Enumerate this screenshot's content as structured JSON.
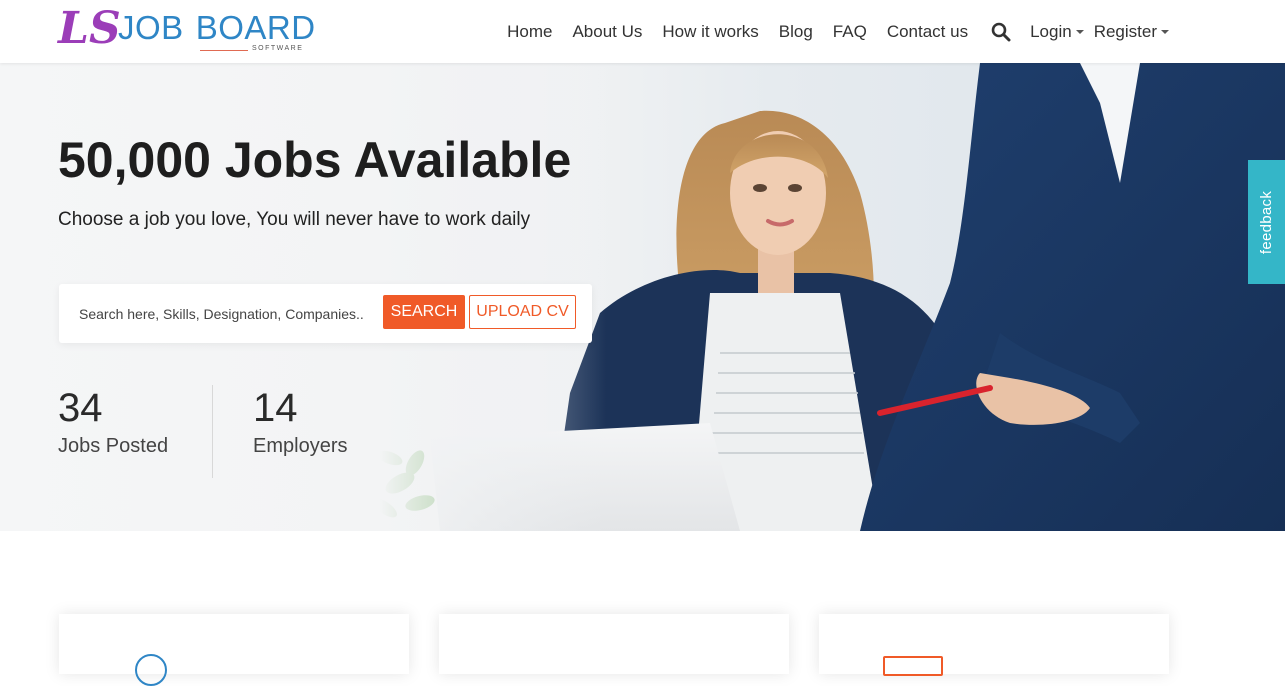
{
  "brand": {
    "mark": "LS",
    "name_first": "JOB",
    "name_second": "BOARD",
    "tagline": "SOFTWARE"
  },
  "nav": {
    "items": [
      "Home",
      "About Us",
      "How it works",
      "Blog",
      "FAQ",
      "Contact us"
    ],
    "search_icon": "search-icon",
    "login_label": "Login",
    "register_label": "Register"
  },
  "hero": {
    "title": "50,000 Jobs Available",
    "subtitle": "Choose a job you love, You will never have to work daily",
    "search": {
      "placeholder": "Search here, Skills, Designation, Companies..",
      "value": "",
      "search_label": "SEARCH",
      "upload_label": "UPLOAD CV"
    },
    "stats": [
      {
        "value": "34",
        "label": "Jobs Posted"
      },
      {
        "value": "14",
        "label": "Employers"
      }
    ]
  },
  "feedback": {
    "label": "feedback"
  },
  "colors": {
    "accent": "#f05a28",
    "brand_blue": "#2f86c6",
    "feedback_teal": "#34b6c8"
  }
}
